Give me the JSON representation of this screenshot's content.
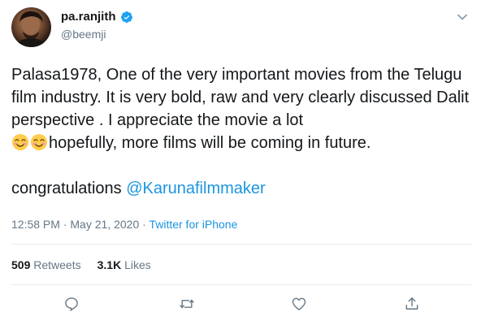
{
  "author": {
    "display_name": "pa.ranjith",
    "handle": "@beemji",
    "verified": true
  },
  "tweet": {
    "paragraphs": [
      "Palasa1978, One of the very important movies from the Telugu film industry. It is very bold, raw and very clearly discussed Dalit perspective . I appreciate the movie a lot",
      "hopefully, more films will be coming in future."
    ],
    "line2": "congratulations ",
    "mention": "@Karunafilmmaker"
  },
  "meta": {
    "time": "12:58 PM",
    "sep1": " · ",
    "date": "May 21, 2020",
    "sep2": " · ",
    "source": "Twitter for iPhone"
  },
  "stats": {
    "retweets_count": "509",
    "retweets_label": "Retweets",
    "likes_count": "3.1K",
    "likes_label": "Likes"
  },
  "icons": {
    "reply": "reply-icon",
    "retweet": "retweet-icon",
    "like": "heart-icon",
    "share": "share-icon",
    "more": "chevron-down-icon",
    "verified": "verified-badge-icon"
  },
  "colors": {
    "link": "#1b95e0",
    "secondary_text": "#657786",
    "verified": "#1da1f2",
    "divider": "#e6ecf0"
  }
}
